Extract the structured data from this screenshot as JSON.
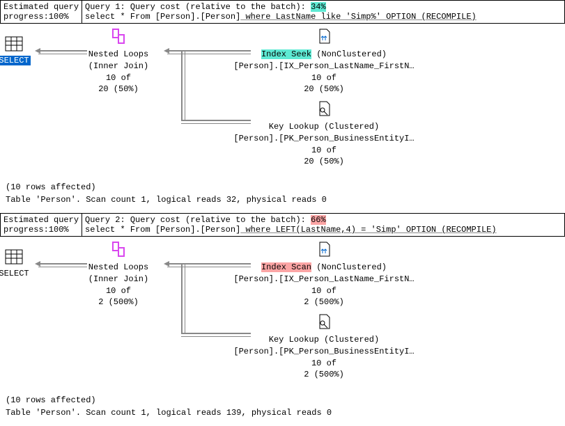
{
  "query1": {
    "progress_label": "Estimated query",
    "progress_value": "progress:100%",
    "title_prefix": "Query 1: Query cost (relative to the batch):",
    "cost": "34%",
    "sql_before": "select * From [Person].[Person]",
    "sql_underlined": " where LastName like 'Simp%' OPTION (RECOMPILE)",
    "select": {
      "label": "SELECT"
    },
    "nested_loops": {
      "title": "Nested Loops",
      "subtitle": "(Inner Join)",
      "rows1": "10 of",
      "rows2": "20 (50%)"
    },
    "index_seek": {
      "op": "Index Seek",
      "type": "(NonClustered)",
      "object": "[Person].[IX_Person_LastName_FirstN…",
      "rows1": "10 of",
      "rows2": "20 (50%)"
    },
    "key_lookup": {
      "op": "Key Lookup",
      "type": "(Clustered)",
      "object": "[Person].[PK_Person_BusinessEntityI…",
      "rows1": "10 of",
      "rows2": "20 (50%)"
    },
    "footer1": "(10 rows affected)",
    "footer2": "Table 'Person'. Scan count 1, logical reads 32, physical reads 0"
  },
  "query2": {
    "progress_label": "Estimated query",
    "progress_value": "progress:100%",
    "title_prefix": "Query 2: Query cost (relative to the batch):",
    "cost": "66%",
    "sql_before": "select * From [Person].[Person]",
    "sql_underlined": " where LEFT(LastName,4) = 'Simp' OPTION (RECOMPILE)",
    "select": {
      "label": "SELECT"
    },
    "nested_loops": {
      "title": "Nested Loops",
      "subtitle": "(Inner Join)",
      "rows1": "10 of",
      "rows2": "2 (500%)"
    },
    "index_scan": {
      "op": "Index Scan",
      "type": "(NonClustered)",
      "object": "[Person].[IX_Person_LastName_FirstN…",
      "rows1": "10 of",
      "rows2": "2 (500%)"
    },
    "key_lookup": {
      "op": "Key Lookup",
      "type": "(Clustered)",
      "object": "[Person].[PK_Person_BusinessEntityI…",
      "rows1": "10 of",
      "rows2": "2 (500%)"
    },
    "footer1": "(10 rows affected)",
    "footer2": "Table 'Person'. Scan count 1, logical reads 139, physical reads 0"
  }
}
